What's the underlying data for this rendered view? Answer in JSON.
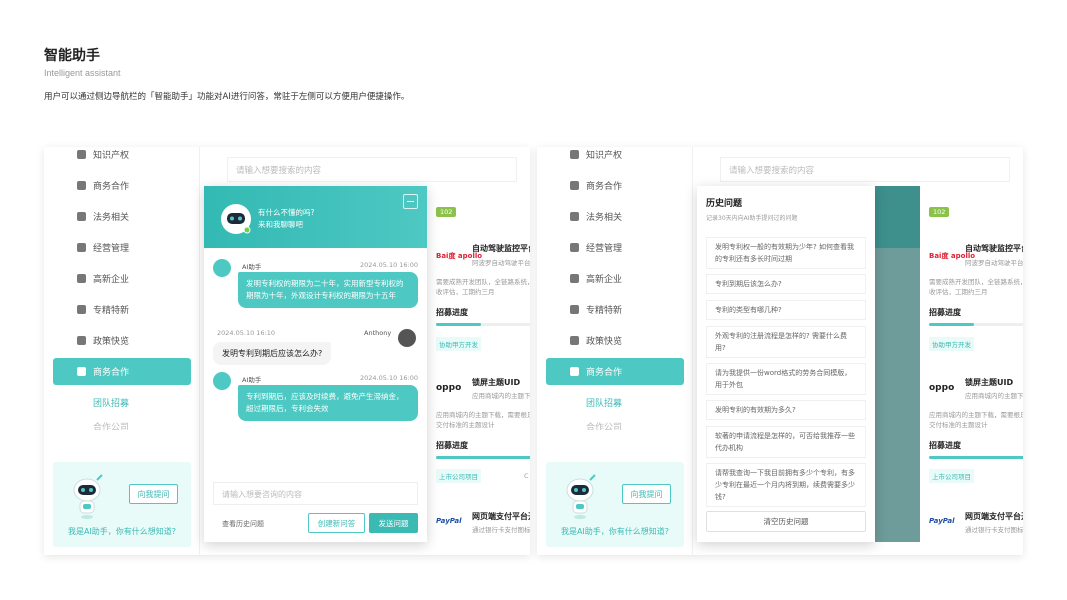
{
  "header": {
    "title": "智能助手",
    "subtitle": "Intelligent assistant",
    "description": "用户可以通过侧边导航栏的「智能助手」功能对AI进行问答，常驻于左侧可以方便用户便捷操作。"
  },
  "sidebar": {
    "items": [
      {
        "label": "知识产权"
      },
      {
        "label": "商务合作"
      },
      {
        "label": "法务相关"
      },
      {
        "label": "经营管理"
      },
      {
        "label": "高新企业"
      },
      {
        "label": "专精特新"
      },
      {
        "label": "政策快览"
      },
      {
        "label": "商务合作"
      },
      {
        "label": "团队招募"
      },
      {
        "label": "合作公司"
      }
    ],
    "active_index": 7,
    "promo": {
      "ask_button": "向我提问",
      "text": "我是AI助手，你有什么想知道?"
    }
  },
  "main": {
    "search_placeholder": "请输入想要搜索的内容",
    "cards": {
      "badge": "102",
      "baidu_logo": "Bai度 apollo",
      "card1_title": "自动驾驶监控平台",
      "card1_line": "阿波罗自动驾驶平台",
      "card1_desc": "需要成熟开发团队，全链路系统，收评估，工期约三月",
      "recruit_label": "招募进度",
      "card1_progress": 0.45,
      "card1_tag": "协助甲方开发",
      "oppo_logo": "oppo",
      "card2_title": "锁屏主题UID",
      "card2_line": "应用商城内的主题下载",
      "card2_desc": "应用商城内的主题下载，需要根足交付标准的主题设计",
      "card2_progress": 1.0,
      "card2_tag": "上市公司项目",
      "card2_extra": "C",
      "paypal_logo": "PayPal",
      "card3_title": "网页端支付平台开",
      "card3_line": "通过银行卡支付图标"
    }
  },
  "chat": {
    "greeting_line1": "有什么不懂的吗?",
    "greeting_line2": "来和我聊聊吧",
    "messages": [
      {
        "sender": "AI助手",
        "time": "2024.05.10 16:00",
        "text": "发明专利权的期限为二十年，实用新型专利权的期限为十年，外观设计专利权的期限为十五年"
      },
      {
        "sender": "Anthony",
        "time": "2024.05.10 16:10",
        "text": "发明专利到期后应该怎么办?"
      },
      {
        "sender": "AI助手",
        "time": "2024.05.10 16:00",
        "text": "专利到期后，应该及时续费，避免产生滞纳金，超过期限后，专利会失效"
      }
    ],
    "input_placeholder": "请输入想要咨询的内容",
    "history_link": "查看历史问题",
    "new_button": "创建新问答",
    "send_button": "发送问题"
  },
  "history": {
    "title": "历史问题",
    "subtitle": "记录30天内向AI助手提问过的问题",
    "questions": [
      "发明专利权一般的有效期为少年? 如何查看我的专利还有多长时间过期",
      "专利到期后该怎么办?",
      "专利的类型有哪几种?",
      "外观专利的注册流程是怎样的? 需要什么费用?",
      "请为我提供一份word格式的劳务合同模版，用于外包",
      "发明专利的有效期为多久?",
      "软著的申请流程是怎样的，可否给我推荐一些代办机构",
      "请帮我查询一下我目前拥有多少个专利，有多少专利在最近一个月内将到期，续费需要多少钱?"
    ],
    "clear_button": "清空历史问题"
  },
  "colors": {
    "accent": "#4ec8c3",
    "accent_dark": "#3bbab4",
    "promo_bg": "#e9fbf9",
    "badge": "#8bc34a"
  }
}
